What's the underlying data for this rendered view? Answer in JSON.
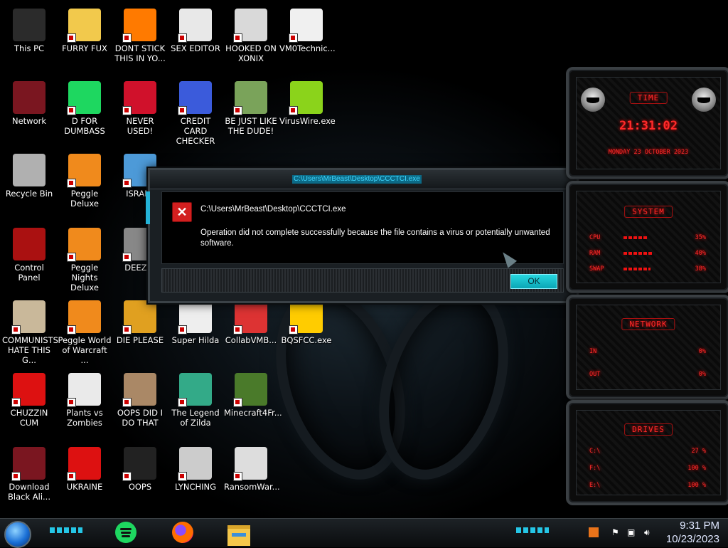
{
  "desktop": {
    "icons": [
      {
        "label": "This PC"
      },
      {
        "label": "FURRY FUX"
      },
      {
        "label": "DONT STICK THIS IN YO..."
      },
      {
        "label": "SEX EDITOR"
      },
      {
        "label": "HOOKED ON XONIX"
      },
      {
        "label": "VM0Technic..."
      },
      {
        "label": "Network"
      },
      {
        "label": "D FOR DUMBASS"
      },
      {
        "label": "NEVER USED!"
      },
      {
        "label": "CREDIT CARD CHECKER"
      },
      {
        "label": "BE JUST LIKE THE DUDE!"
      },
      {
        "label": "VirusWire.exe"
      },
      {
        "label": "Recycle Bin"
      },
      {
        "label": "Peggle Deluxe"
      },
      {
        "label": "ISRAEL"
      },
      {
        "label": "Control Panel"
      },
      {
        "label": "Peggle Nights Deluxe"
      },
      {
        "label": "DEEZ N"
      },
      {
        "label": "COMMUNISTS HATE THIS G..."
      },
      {
        "label": "Peggle World of Warcraft ..."
      },
      {
        "label": "DIE PLEASE"
      },
      {
        "label": "Super Hilda"
      },
      {
        "label": "CollabVMB..."
      },
      {
        "label": "BQSFCC.exe"
      },
      {
        "label": "CHUZZIN CUM"
      },
      {
        "label": "Plants vs Zombies"
      },
      {
        "label": "OOPS DID I DO THAT"
      },
      {
        "label": "The Legend of Zilda"
      },
      {
        "label": "Minecraft4Fr..."
      },
      {
        "label": "Download Black Ali..."
      },
      {
        "label": "UKRAINE"
      },
      {
        "label": "OOPS"
      },
      {
        "label": "LYNCHING"
      },
      {
        "label": "RansomWar..."
      }
    ]
  },
  "dialog": {
    "title": "C:\\Users\\MrBeast\\Desktop\\CCCTCI.exe",
    "heading": "C:\\Users\\MrBeast\\Desktop\\CCCTCI.exe",
    "message": "Operation did not complete successfully because the file contains a virus or potentially unwanted software.",
    "ok_label": "OK",
    "icon": "error-x-icon"
  },
  "gadgets": {
    "time": {
      "header": "TIME",
      "clock": "21:31:02",
      "date": "MONDAY 23 OCTOBER 2023"
    },
    "system": {
      "header": "SYSTEM",
      "rows": [
        {
          "key": "CPU",
          "value": "35%",
          "level": 0.35
        },
        {
          "key": "RAM",
          "value": "40%",
          "level": 0.4
        },
        {
          "key": "SWAP",
          "value": "38%",
          "level": 0.38
        }
      ]
    },
    "network": {
      "header": "NETWORK",
      "rows": [
        {
          "key": "IN",
          "value": "0%"
        },
        {
          "key": "OUT",
          "value": "0%"
        }
      ]
    },
    "drives": {
      "header": "DRIVES",
      "rows": [
        {
          "key": "C:\\",
          "value": "27 %"
        },
        {
          "key": "F:\\",
          "value": "100 %"
        },
        {
          "key": "E:\\",
          "value": "100 %"
        }
      ]
    }
  },
  "taskbar": {
    "pinned": [
      "spotify-icon",
      "firefox-icon",
      "file-explorer-icon"
    ],
    "tray_icons": [
      "up-chevron-icon",
      "network-icon",
      "volume-icon"
    ],
    "time": "9:31 PM",
    "date": "10/23/2023"
  },
  "colors": {
    "accent_cyan": "#25c6e6",
    "gadget_red": "#ff2b2b",
    "error_red": "#d21f1f"
  }
}
